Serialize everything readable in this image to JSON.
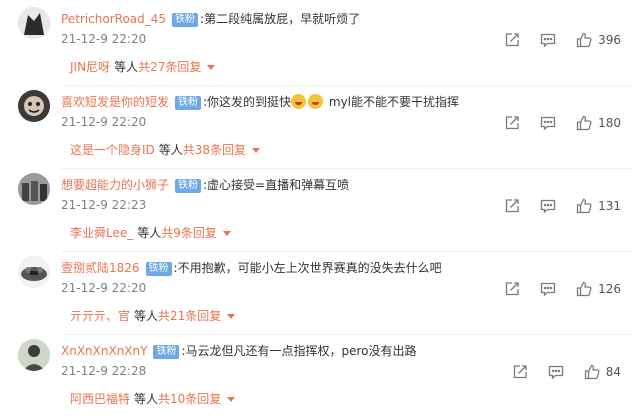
{
  "comments": [
    {
      "username": "PetrichorRoad_45",
      "badge": "铁粉",
      "text": ":第二段纯属放屁，早就听烦了",
      "time": "21-12-9 22:20",
      "likes": "396",
      "reply_user": "JIN尼呀",
      "reply_mid": "等人",
      "reply_count": "共27条回复"
    },
    {
      "username": "喜欢短发是你的短发",
      "badge": "铁粉",
      "text": ":你这发的到挺快",
      "text2": " myl能不能不要干扰指挥",
      "time": "21-12-9 22:20",
      "likes": "180",
      "reply_user": "这是一个隐身ID",
      "reply_mid": "等人",
      "reply_count": "共38条回复"
    },
    {
      "username": "想要超能力的小狮子",
      "badge": "铁粉",
      "text": ":虚心接受=直播和弹幕互喷",
      "time": "21-12-9 22:23",
      "likes": "131",
      "reply_user": "李业舜Lee_",
      "reply_mid": "等人",
      "reply_count": "共9条回复"
    },
    {
      "username": "壹捌贰陆1826",
      "badge": "铁粉",
      "text": ":不用抱歉，可能小左上次世界赛真的没失去什么吧",
      "time": "21-12-9 22:20",
      "likes": "126",
      "reply_user": "亓亓亓、官",
      "reply_mid": "等人",
      "reply_count": "共21条回复"
    },
    {
      "username": "XnXnXnXnXnY",
      "badge": "铁粉",
      "text": ":马云龙但凡还有一点指挥权，pero没有出路",
      "time": "21-12-9 22:28",
      "likes": "84",
      "reply_user": "阿西巴福特",
      "reply_mid": "等人",
      "reply_count": "共10条回复"
    }
  ],
  "icons": {
    "share": "share-icon",
    "comment": "comment-icon",
    "like": "thumbs-up-icon",
    "expand": "caret-down-icon"
  },
  "colors": {
    "username": "#eb7350",
    "badge": "#6ea8e6",
    "timestamp": "#808080",
    "icon": "#7a7a7a"
  }
}
